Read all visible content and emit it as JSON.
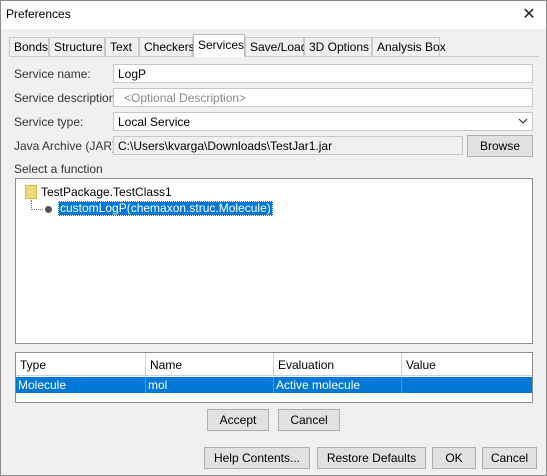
{
  "window": {
    "title": "Preferences"
  },
  "tabs": [
    {
      "label": "Bonds"
    },
    {
      "label": "Structure"
    },
    {
      "label": "Text"
    },
    {
      "label": "Checkers"
    },
    {
      "label": "Services",
      "active": true
    },
    {
      "label": "Save/Load"
    },
    {
      "label": "3D Options"
    },
    {
      "label": "Analysis Box"
    }
  ],
  "form": {
    "service_name_label": "Service name:",
    "service_name_value": "LogP",
    "service_description_label": "Service description:",
    "service_description_placeholder": "<Optional Description>",
    "service_type_label": "Service type:",
    "service_type_value": "Local Service",
    "jar_label": "Java Archive (JAR):",
    "jar_value": "C:\\Users\\kvarga\\Downloads\\TestJar1.jar",
    "browse_label": "Browse",
    "select_function_label": "Select a function"
  },
  "tree": {
    "class_label": "TestPackage.TestClass1",
    "method_label": "customLogP(chemaxon.struc.Molecule)"
  },
  "table": {
    "headers": [
      "Type",
      "Name",
      "Evaluation",
      "Value"
    ],
    "rows": [
      {
        "type": "Molecule",
        "name": "mol",
        "evaluation": "Active molecule",
        "value": ""
      }
    ]
  },
  "panel_buttons": {
    "accept": "Accept",
    "cancel": "Cancel"
  },
  "footer_buttons": {
    "help": "Help Contents...",
    "restore": "Restore Defaults",
    "ok": "OK",
    "cancel": "Cancel"
  },
  "colors": {
    "selection": "#0078d7",
    "folder": "#f3d677"
  }
}
